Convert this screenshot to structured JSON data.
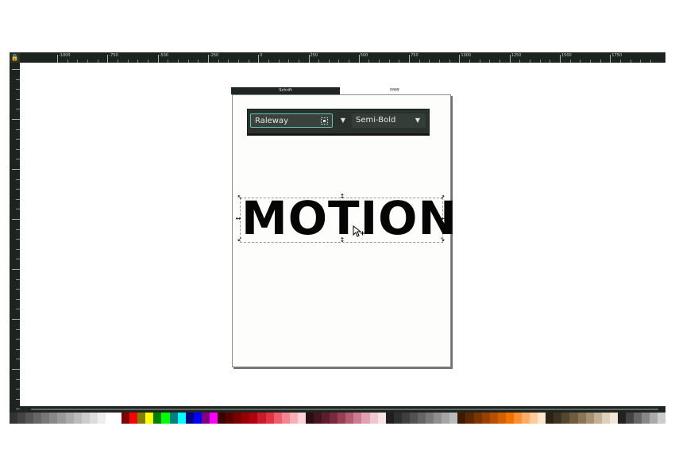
{
  "ruler": {
    "corner_icon": "lock-icon",
    "labels": [
      "-1000",
      "-750",
      "-500",
      "-250",
      "0",
      "250",
      "500",
      "750",
      "1000",
      "1250",
      "1500",
      "1750"
    ]
  },
  "page_tabs": {
    "active": "Schrift",
    "inactive": "Pfffff"
  },
  "font_toolbar": {
    "family": "Raleway",
    "style": "Semi-Bold"
  },
  "canvas_text": "MOTION",
  "palette": {
    "colors": [
      "#333333",
      "#444444",
      "#555555",
      "#666666",
      "#777777",
      "#888888",
      "#999999",
      "#aaaaaa",
      "#bbbbbb",
      "#cccccc",
      "#dddddd",
      "#eeeeee",
      "#ffffff",
      "#ffffff",
      "#800000",
      "#ff0000",
      "#808000",
      "#ffff00",
      "#008000",
      "#00ff00",
      "#008080",
      "#00ffff",
      "#000080",
      "#0000ff",
      "#800080",
      "#ff00ff",
      "#3b0000",
      "#5a0000",
      "#7a0000",
      "#990000",
      "#b30010",
      "#cc1a2b",
      "#e03344",
      "#ef5c6b",
      "#f58490",
      "#f9adb5",
      "#fcd3d8",
      "#2b0e14",
      "#44141f",
      "#5e1d2d",
      "#7a2a3e",
      "#973f55",
      "#b35b70",
      "#cc7c8f",
      "#e0a1b0",
      "#efc7d0",
      "#f7e2e7",
      "#1f1f1f",
      "#2f2f2f",
      "#3f3f3f",
      "#525252",
      "#656565",
      "#7a7a7a",
      "#8f8f8f",
      "#a5a5a5",
      "#bbbbbb",
      "#3d1a00",
      "#5c2800",
      "#7a3500",
      "#994200",
      "#b85000",
      "#d65f00",
      "#f27200",
      "#ff8f33",
      "#ffad66",
      "#ffcc99",
      "#ffe6cc",
      "#2a2416",
      "#3d3320",
      "#55472e",
      "#6e5d3f",
      "#8a7656",
      "#a79172",
      "#c4b095",
      "#ded0ba",
      "#f0e7d9",
      "#222222",
      "#444444",
      "#666666",
      "#888888",
      "#aaaaaa",
      "#cccccc"
    ]
  }
}
